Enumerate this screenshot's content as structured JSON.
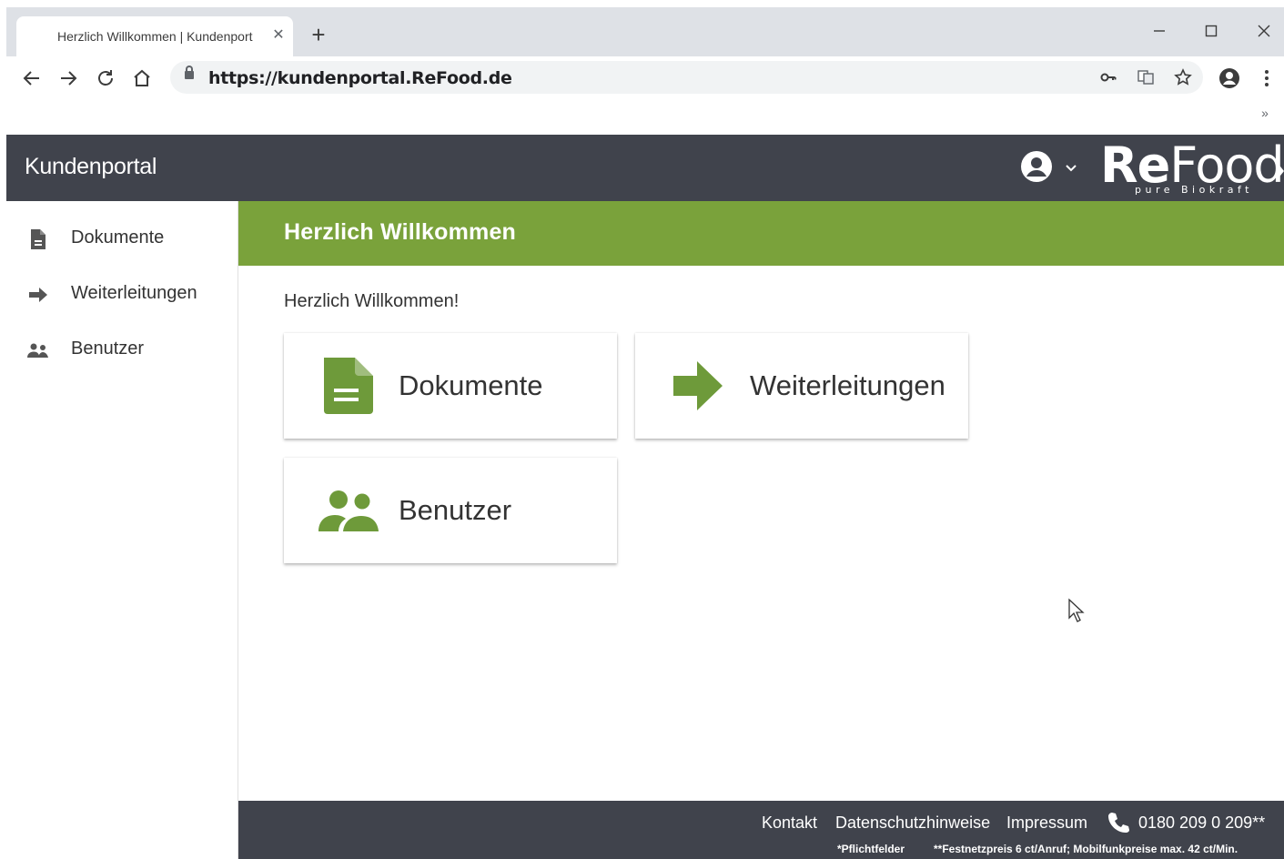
{
  "browser": {
    "tab_title": "Herzlich Willkommen | Kundenportal",
    "new_tab": "+",
    "url": "https://kundenportal.ReFood.de",
    "bookmarks_more": "»"
  },
  "header": {
    "brand": "Kundenportal",
    "logo_bold": "Re",
    "logo_rest": "Food",
    "logo_tagline": "pure Biokraft"
  },
  "sidebar": {
    "items": [
      {
        "label": "Dokumente",
        "icon": "document-icon"
      },
      {
        "label": "Weiterleitungen",
        "icon": "arrow-right-icon"
      },
      {
        "label": "Benutzer",
        "icon": "users-icon"
      }
    ]
  },
  "main": {
    "banner_title": "Herzlich Willkommen",
    "welcome_text": "Herzlich Willkommen!",
    "cards": [
      {
        "label": "Dokumente",
        "icon": "document-icon"
      },
      {
        "label": "Weiterleitungen",
        "icon": "arrow-right-icon"
      },
      {
        "label": "Benutzer",
        "icon": "users-icon"
      }
    ]
  },
  "footer": {
    "contact": "Kontakt",
    "privacy": "Datenschutzhinweise",
    "imprint": "Impressum",
    "phone": "0180 209 0 209**",
    "note_required": "*Pflichtfelder",
    "note_price": "**Festnetzpreis 6 ct/Anruf; Mobilfunkpreise max. 42 ct/Min."
  },
  "colors": {
    "header_bg": "#40434c",
    "accent_green": "#7aa23b",
    "icon_green": "#6e9a3a",
    "sidebar_icon": "#555555"
  }
}
